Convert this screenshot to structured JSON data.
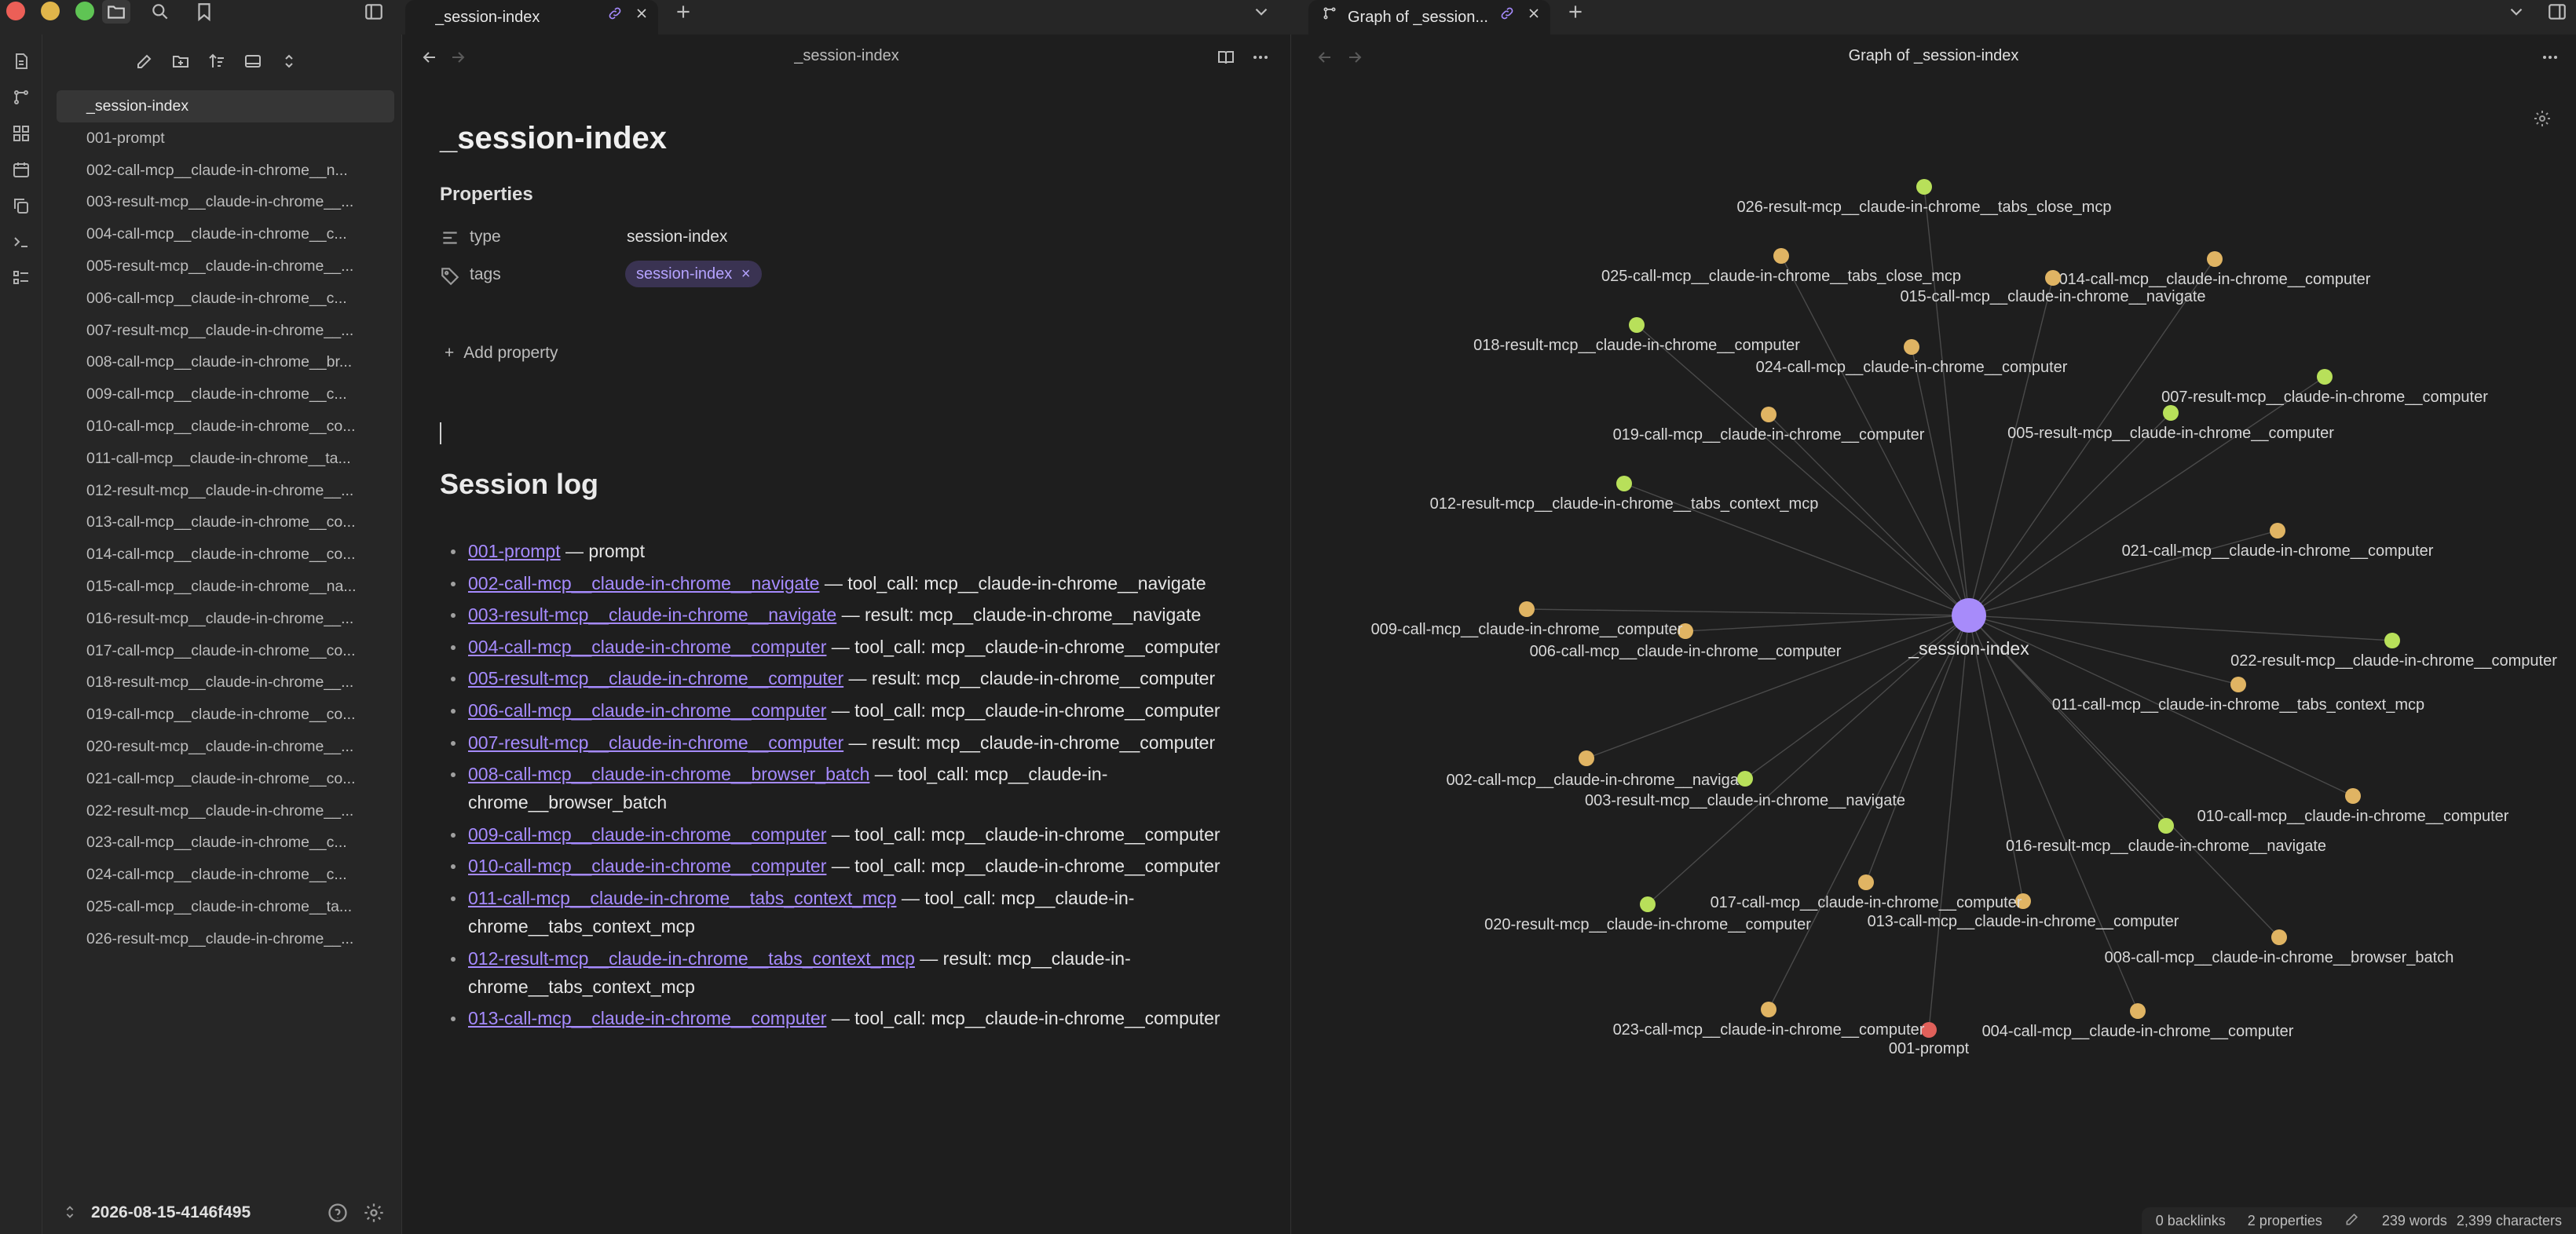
{
  "tabs": [
    {
      "title": "_session-index"
    },
    {
      "title": "Graph of _session..."
    }
  ],
  "explorer": {
    "files": [
      "_session-index",
      "001-prompt",
      "002-call-mcp__claude-in-chrome__n...",
      "003-result-mcp__claude-in-chrome__...",
      "004-call-mcp__claude-in-chrome__c...",
      "005-result-mcp__claude-in-chrome__...",
      "006-call-mcp__claude-in-chrome__c...",
      "007-result-mcp__claude-in-chrome__...",
      "008-call-mcp__claude-in-chrome__br...",
      "009-call-mcp__claude-in-chrome__c...",
      "010-call-mcp__claude-in-chrome__co...",
      "011-call-mcp__claude-in-chrome__ta...",
      "012-result-mcp__claude-in-chrome__...",
      "013-call-mcp__claude-in-chrome__co...",
      "014-call-mcp__claude-in-chrome__co...",
      "015-call-mcp__claude-in-chrome__na...",
      "016-result-mcp__claude-in-chrome__...",
      "017-call-mcp__claude-in-chrome__co...",
      "018-result-mcp__claude-in-chrome__...",
      "019-call-mcp__claude-in-chrome__co...",
      "020-result-mcp__claude-in-chrome__...",
      "021-call-mcp__claude-in-chrome__co...",
      "022-result-mcp__claude-in-chrome__...",
      "023-call-mcp__claude-in-chrome__c...",
      "024-call-mcp__claude-in-chrome__c...",
      "025-call-mcp__claude-in-chrome__ta...",
      "026-result-mcp__claude-in-chrome__..."
    ],
    "vault_name": "2026-08-15-4146f495"
  },
  "editor": {
    "header_title": "_session-index",
    "note_title": "_session-index",
    "properties_heading": "Properties",
    "prop_type_key": "type",
    "prop_type_value": "session-index",
    "prop_tags_key": "tags",
    "prop_tags_value": "session-index",
    "add_property": "Add property",
    "session_heading": "Session log",
    "log": [
      {
        "link": "001-prompt",
        "desc": " — prompt"
      },
      {
        "link": "002-call-mcp__claude-in-chrome__navigate",
        "desc": " — tool_call: mcp__claude-in-chrome__navigate"
      },
      {
        "link": "003-result-mcp__claude-in-chrome__navigate",
        "desc": " — result: mcp__claude-in-chrome__navigate"
      },
      {
        "link": "004-call-mcp__claude-in-chrome__computer",
        "desc": " — tool_call: mcp__claude-in-chrome__computer"
      },
      {
        "link": "005-result-mcp__claude-in-chrome__computer",
        "desc": " — result: mcp__claude-in-chrome__computer"
      },
      {
        "link": "006-call-mcp__claude-in-chrome__computer",
        "desc": " — tool_call: mcp__claude-in-chrome__computer"
      },
      {
        "link": "007-result-mcp__claude-in-chrome__computer",
        "desc": " — result: mcp__claude-in-chrome__computer"
      },
      {
        "link": "008-call-mcp__claude-in-chrome__browser_batch",
        "desc": " — tool_call: mcp__claude-in-chrome__browser_batch"
      },
      {
        "link": "009-call-mcp__claude-in-chrome__computer",
        "desc": " — tool_call: mcp__claude-in-chrome__computer"
      },
      {
        "link": "010-call-mcp__claude-in-chrome__computer",
        "desc": " — tool_call: mcp__claude-in-chrome__computer"
      },
      {
        "link": "011-call-mcp__claude-in-chrome__tabs_context_mcp",
        "desc": " — tool_call: mcp__claude-in-chrome__tabs_context_mcp"
      },
      {
        "link": "012-result-mcp__claude-in-chrome__tabs_context_mcp",
        "desc": " — result: mcp__claude-in-chrome__tabs_context_mcp"
      },
      {
        "link": "013-call-mcp__claude-in-chrome__computer",
        "desc": " — tool_call: mcp__claude-in-chrome__computer"
      }
    ]
  },
  "graph": {
    "header_title": "Graph of _session-index",
    "center": {
      "label": "_session-index",
      "color": "#a78bfa"
    },
    "colors": {
      "call": "#e0b463",
      "result": "#b8e05a",
      "prompt": "#e0605a",
      "edge": "#4a4a4a"
    },
    "nodes": [
      {
        "label": "001-prompt",
        "kind": "prompt"
      },
      {
        "label": "002-call-mcp__claude-in-chrome__navigate",
        "kind": "call"
      },
      {
        "label": "003-result-mcp__claude-in-chrome__navigate",
        "kind": "result"
      },
      {
        "label": "004-call-mcp__claude-in-chrome__computer",
        "kind": "call"
      },
      {
        "label": "005-result-mcp__claude-in-chrome__computer",
        "kind": "result"
      },
      {
        "label": "006-call-mcp__claude-in-chrome__computer",
        "kind": "call"
      },
      {
        "label": "007-result-mcp__claude-in-chrome__computer",
        "kind": "result"
      },
      {
        "label": "008-call-mcp__claude-in-chrome__browser_batch",
        "kind": "call"
      },
      {
        "label": "009-call-mcp__claude-in-chrome__computer",
        "kind": "call"
      },
      {
        "label": "010-call-mcp__claude-in-chrome__computer",
        "kind": "call"
      },
      {
        "label": "011-call-mcp__claude-in-chrome__tabs_context_mcp",
        "kind": "call"
      },
      {
        "label": "012-result-mcp__claude-in-chrome__tabs_context_mcp",
        "kind": "result"
      },
      {
        "label": "013-call-mcp__claude-in-chrome__computer",
        "kind": "call"
      },
      {
        "label": "014-call-mcp__claude-in-chrome__computer",
        "kind": "call"
      },
      {
        "label": "015-call-mcp__claude-in-chrome__navigate",
        "kind": "call"
      },
      {
        "label": "016-result-mcp__claude-in-chrome__navigate",
        "kind": "result"
      },
      {
        "label": "017-call-mcp__claude-in-chrome__computer",
        "kind": "call"
      },
      {
        "label": "018-result-mcp__claude-in-chrome__computer",
        "kind": "result"
      },
      {
        "label": "019-call-mcp__claude-in-chrome__computer",
        "kind": "call"
      },
      {
        "label": "020-result-mcp__claude-in-chrome__computer",
        "kind": "result"
      },
      {
        "label": "021-call-mcp__claude-in-chrome__computer",
        "kind": "call"
      },
      {
        "label": "022-result-mcp__claude-in-chrome__computer",
        "kind": "result"
      },
      {
        "label": "023-call-mcp__claude-in-chrome__computer",
        "kind": "call"
      },
      {
        "label": "024-call-mcp__claude-in-chrome__computer",
        "kind": "call"
      },
      {
        "label": "025-call-mcp__claude-in-chrome__tabs_close_mcp",
        "kind": "call"
      },
      {
        "label": "026-result-mcp__claude-in-chrome__tabs_close_mcp",
        "kind": "result"
      }
    ]
  },
  "statusbar": {
    "backlinks": "0 backlinks",
    "properties": "2 properties",
    "words": "239 words",
    "characters": "2,399 characters"
  },
  "icons": [
    "sidebar-toggle-icon",
    "search-icon",
    "bookmark-icon",
    "folder-icon",
    "new-note-icon",
    "new-folder-icon",
    "sort-icon",
    "collapse-icon",
    "link-icon",
    "close-icon",
    "plus-icon",
    "chevron-down-icon",
    "back-arrow-icon",
    "forward-arrow-icon",
    "book-icon",
    "more-icon",
    "settings-icon",
    "help-icon",
    "graph-icon",
    "tag-icon",
    "list-icon"
  ]
}
